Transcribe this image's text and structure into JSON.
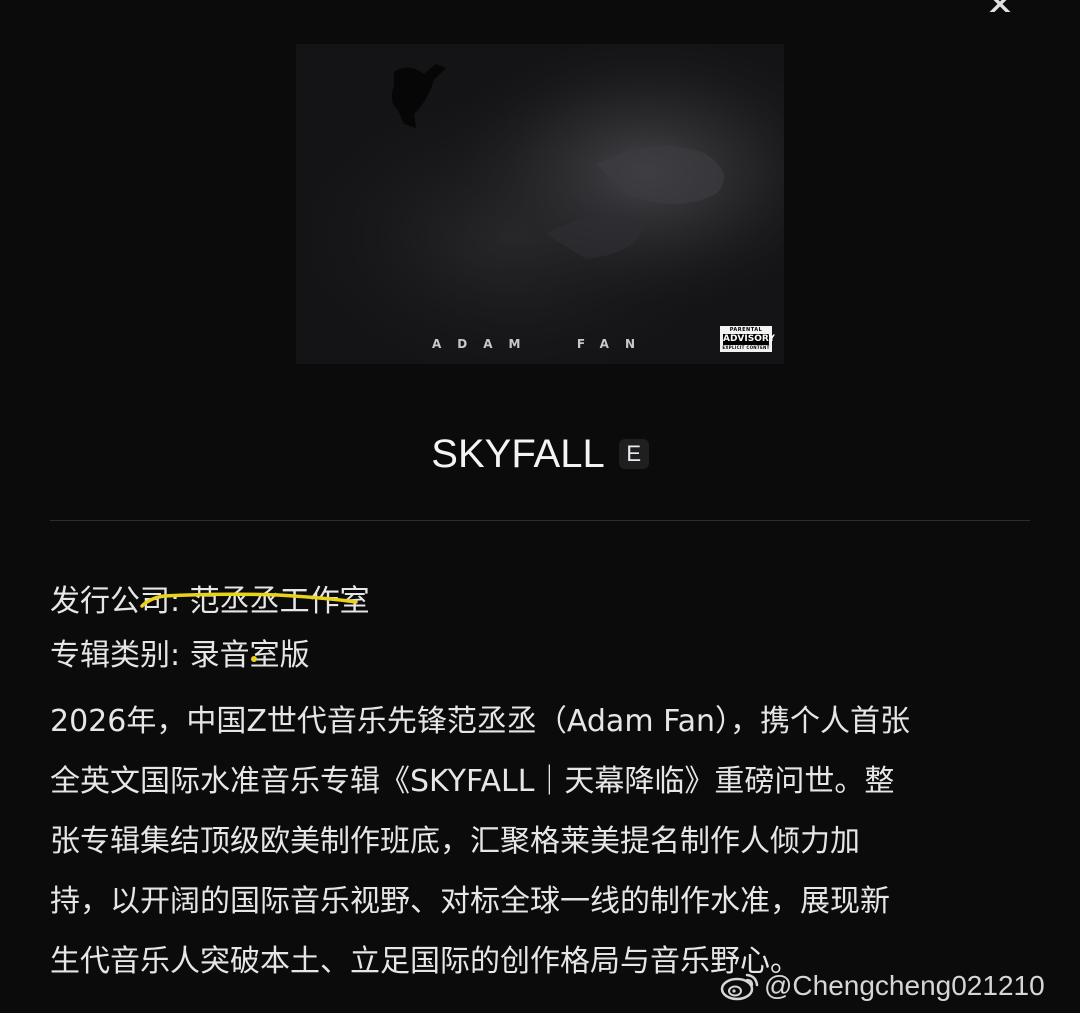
{
  "album": {
    "cover_artist_text": "ADAM  FAN",
    "title": "SKYFALL",
    "explicit_badge": "E",
    "advisory": {
      "line1": "PARENTAL",
      "line2": "ADVISORY",
      "line3": "EXPLICIT CONTENT"
    }
  },
  "meta": {
    "publisher_label": "发行公司:",
    "publisher_value": "范丞丞工作室",
    "type_label": "专辑类别:",
    "type_value": "录音室版"
  },
  "description": {
    "lines": [
      "2026年，中国Z世代音乐先锋范丞丞（Adam Fan），携个人首张",
      "全英文国际水准音乐专辑《SKYFALL｜天幕降临》重磅问世。整",
      "张专辑集结顶级欧美制作班底，汇聚格莱美提名制作人倾力加",
      "持，以开阔的国际音乐视野、对标全球一线的制作水准，展现新",
      "生代音乐人突破本土、立足国际的创作格局与音乐野心。"
    ]
  },
  "watermark": {
    "handle": "@Chengcheng021210",
    "icon": "weibo-icon"
  },
  "icons": {
    "close": "close-icon"
  },
  "colors": {
    "background": "#0b0b0c",
    "text": "#e6e6e6",
    "highlight": "#e8d21a"
  }
}
